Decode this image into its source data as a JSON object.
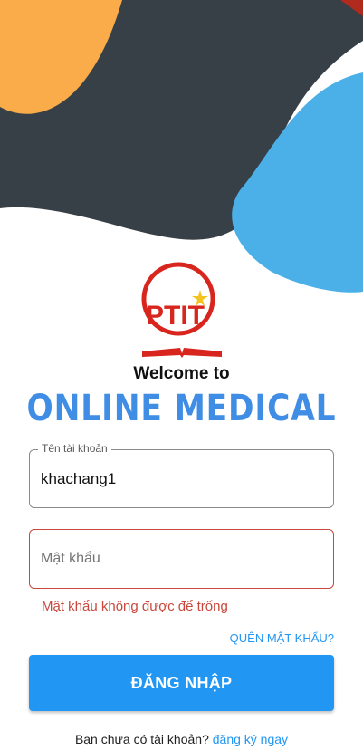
{
  "logo": {
    "text": "PTIT"
  },
  "welcome": {
    "title": "Welcome to",
    "app_name": "ONLINE MEDICAL"
  },
  "login_form": {
    "username": {
      "label": "Tên tài khoản",
      "value": "khachang1"
    },
    "password": {
      "placeholder": "Mật khẩu",
      "value": "",
      "error": "Mật khẩu không được để trống"
    },
    "forgot_link": "QUÊN MẬT KHẨU?",
    "submit_label": "ĐĂNG NHẬP",
    "signup_prompt": "Bạn chưa có tài khoản?",
    "signup_link": "đăng ký ngay"
  },
  "colors": {
    "primary": "#2196f3",
    "error": "#c9473c",
    "title_blue": "#3f8de4",
    "blob_orange": "#f9ac49",
    "blob_dark": "#384047",
    "blob_blue": "#4ab0e7",
    "logo_red": "#d8251d"
  }
}
